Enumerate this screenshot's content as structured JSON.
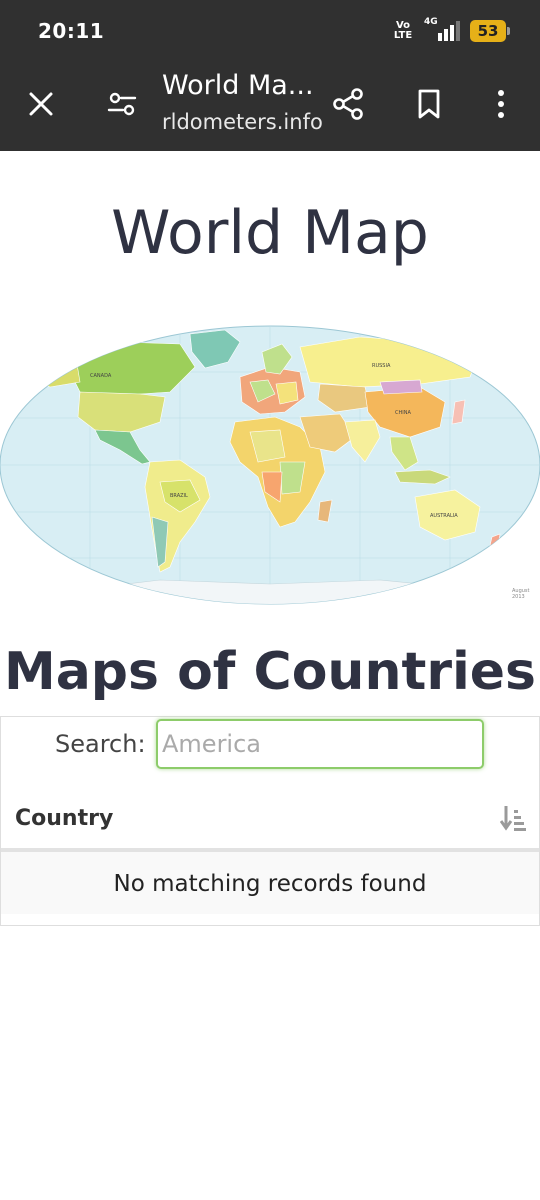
{
  "status_bar": {
    "time": "20:11",
    "volte_line1": "Vo",
    "volte_line2": "LTE",
    "network": "4G",
    "battery": "53",
    "battery_color": "#e6b018"
  },
  "app_bar": {
    "title": "World Ma...",
    "url": "rldometers.info",
    "icons": [
      "close-icon",
      "page-settings-icon",
      "share-icon",
      "bookmark-icon",
      "more-vert-icon"
    ],
    "background": "#303030"
  },
  "page": {
    "title": "World Map",
    "map_note": "August 2013",
    "section_title": "Maps of Countries",
    "search": {
      "label": "Search:",
      "value": "America",
      "border_color": "#8dcc6a"
    },
    "table": {
      "columns": [
        "Country"
      ],
      "empty_message": "No matching records found"
    }
  }
}
